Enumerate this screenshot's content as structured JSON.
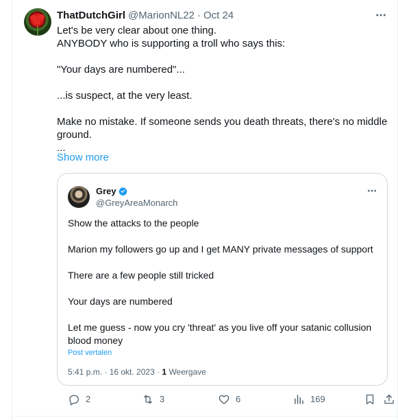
{
  "tweet": {
    "author": {
      "name": "ThatDutchGirl",
      "handle": "@MarionNL22",
      "separator": "·",
      "date": "Oct 24",
      "avatar_icon": "red-poppy-avatar"
    },
    "more_icon": "more-horizontal-icon",
    "text_lines": [
      "Let's be very clear about one thing.",
      "ANYBODY who is supporting a troll who says this:",
      "",
      "\"Your days are numbered\"...",
      "",
      "...is suspect, at the very least.",
      "",
      "Make no mistake. If someone sends you death threats, there's no middle",
      "ground.",
      "..."
    ],
    "show_more": "Show more",
    "quote": {
      "name": "Grey",
      "handle": "@GreyAreaMonarch",
      "verified": true,
      "verified_color": "#1d9bf0",
      "avatar_icon": "profile-photo-avatar",
      "paragraphs": [
        "Show the attacks to the people",
        "Marion my followers go up and I get MANY private messages of support",
        "There are a few people still tricked",
        "Your days are numbered",
        "Let me guess - now you cry 'threat' as you live off your satanic collusion blood money"
      ],
      "translate": "Post vertalen",
      "meta_time": "5:41 p.m. · 16 okt. 2023 · ",
      "meta_views_count": "1",
      "meta_views_label": " Weergave"
    },
    "actions": {
      "reply": {
        "icon": "reply-icon",
        "count": "2"
      },
      "retweet": {
        "icon": "retweet-icon",
        "count": "3"
      },
      "like": {
        "icon": "heart-icon",
        "count": "6"
      },
      "views": {
        "icon": "analytics-icon",
        "count": "169"
      },
      "bookmark": {
        "icon": "bookmark-icon"
      },
      "share": {
        "icon": "share-icon"
      }
    },
    "colors": {
      "text": "#0f1419",
      "secondary": "#536471",
      "link": "#1d9bf0",
      "border": "#cfd9de"
    }
  }
}
